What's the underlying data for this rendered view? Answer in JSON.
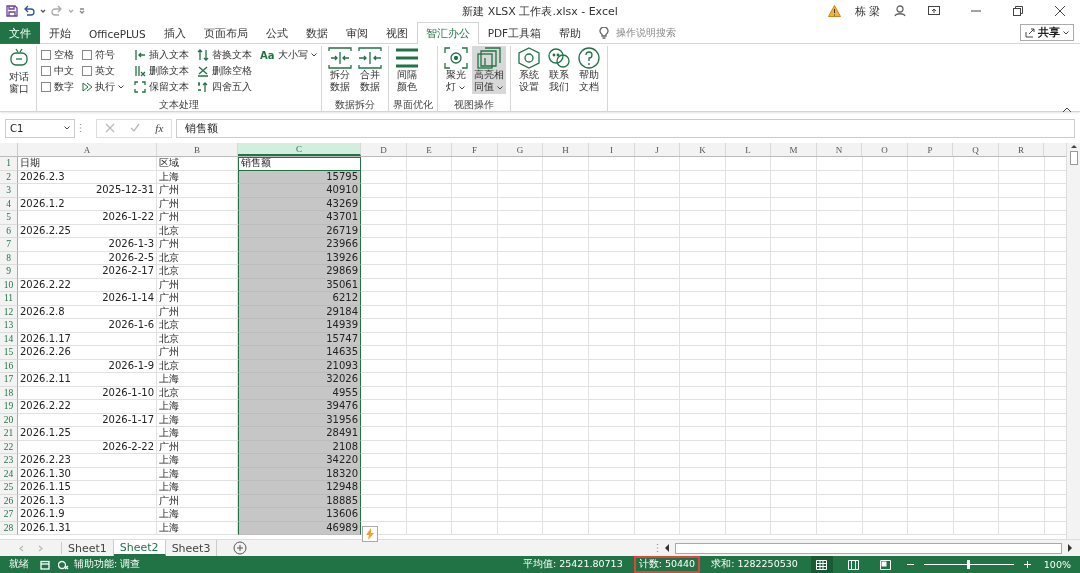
{
  "window": {
    "title": "新建 XLSX 工作表.xlsx  -  Excel",
    "user": "栋 梁"
  },
  "tabs": [
    {
      "label": "文件",
      "kind": "file",
      "selected": false
    },
    {
      "label": "开始",
      "kind": "tab",
      "selected": false
    },
    {
      "label": "OfficePLUS",
      "kind": "tab",
      "selected": false
    },
    {
      "label": "插入",
      "kind": "tab",
      "selected": false
    },
    {
      "label": "页面布局",
      "kind": "tab",
      "selected": false
    },
    {
      "label": "公式",
      "kind": "tab",
      "selected": false
    },
    {
      "label": "数据",
      "kind": "tab",
      "selected": false
    },
    {
      "label": "审阅",
      "kind": "tab",
      "selected": false
    },
    {
      "label": "视图",
      "kind": "tab",
      "selected": false
    },
    {
      "label": "智汇办公",
      "kind": "tab",
      "selected": true
    },
    {
      "label": "PDF工具箱",
      "kind": "tab",
      "selected": false
    },
    {
      "label": "帮助",
      "kind": "tab",
      "selected": false
    }
  ],
  "search": {
    "placeholder": "操作说明搜索"
  },
  "share_button": {
    "label": "共享"
  },
  "ribbon": {
    "chat_button": {
      "lines": [
        "对话",
        "窗口"
      ]
    },
    "text_group": {
      "label": "文本处理",
      "checkboxes": [
        {
          "label": "空格",
          "checked": false
        },
        {
          "label": "符号",
          "checked": false
        },
        {
          "label": "中文",
          "checked": false
        },
        {
          "label": "英文",
          "checked": false
        },
        {
          "label": "数字",
          "checked": false
        }
      ],
      "run_button": {
        "label": "执行"
      },
      "tools": [
        {
          "label": "插入文本"
        },
        {
          "label": "替换文本"
        },
        {
          "label": "删除文本"
        },
        {
          "label": "删除空格"
        },
        {
          "label": "保留文本"
        },
        {
          "label": "四舍五入"
        }
      ],
      "case_button": {
        "prefix": "Aa",
        "label": "大小写"
      }
    },
    "groups": [
      {
        "label": "数据拆分",
        "buttons": [
          {
            "lines": [
              "拆分",
              "数据"
            ],
            "dropdown": false,
            "selected": false
          },
          {
            "lines": [
              "合并",
              "数据"
            ],
            "dropdown": false,
            "selected": false
          }
        ]
      },
      {
        "label": "界面优化",
        "buttons": [
          {
            "lines": [
              "间隔",
              "颜色"
            ],
            "dropdown": false,
            "selected": false
          }
        ]
      },
      {
        "label": "视图操作",
        "buttons": [
          {
            "lines": [
              "聚光",
              "灯"
            ],
            "dropdown": true,
            "selected": false
          },
          {
            "lines": [
              "高亮相",
              "同值"
            ],
            "dropdown": true,
            "selected": true
          }
        ]
      },
      {
        "buttons": [
          {
            "lines": [
              "系统",
              "设置"
            ],
            "dropdown": false,
            "selected": false
          },
          {
            "lines": [
              "联系",
              "我们"
            ],
            "dropdown": false,
            "selected": false
          },
          {
            "lines": [
              "帮助",
              "文档"
            ],
            "dropdown": false,
            "selected": false
          }
        ]
      }
    ]
  },
  "formula_bar": {
    "name_box": "C1",
    "fx": "fx",
    "formula": "销售额"
  },
  "table": {
    "columns": [
      {
        "label": "A",
        "selected": false
      },
      {
        "label": "B",
        "selected": false
      },
      {
        "label": "C",
        "selected": true
      },
      {
        "label": "D",
        "selected": false
      },
      {
        "label": "E",
        "selected": false
      },
      {
        "label": "F",
        "selected": false
      },
      {
        "label": "G",
        "selected": false
      },
      {
        "label": "H",
        "selected": false
      },
      {
        "label": "I",
        "selected": false
      },
      {
        "label": "J",
        "selected": false
      },
      {
        "label": "K",
        "selected": false
      },
      {
        "label": "L",
        "selected": false
      },
      {
        "label": "M",
        "selected": false
      },
      {
        "label": "N",
        "selected": false
      },
      {
        "label": "O",
        "selected": false
      },
      {
        "label": "P",
        "selected": false
      },
      {
        "label": "Q",
        "selected": false
      },
      {
        "label": "R",
        "selected": false
      }
    ],
    "rows": [
      {
        "number": "1",
        "cells": [
          {
            "text": "日期",
            "kind": "text"
          },
          {
            "text": "区域",
            "kind": "text"
          },
          {
            "text": "销售额",
            "kind": "text"
          }
        ]
      },
      {
        "number": "2",
        "cells": [
          {
            "text": "2026.2.3",
            "kind": "text"
          },
          {
            "text": "上海",
            "kind": "text"
          },
          {
            "text": "15795",
            "kind": "number"
          }
        ]
      },
      {
        "number": "3",
        "cells": [
          {
            "text": "2025-12-31",
            "kind": "date"
          },
          {
            "text": "广州",
            "kind": "text"
          },
          {
            "text": "40910",
            "kind": "number"
          }
        ]
      },
      {
        "number": "4",
        "cells": [
          {
            "text": "2026.1.2",
            "kind": "text"
          },
          {
            "text": "广州",
            "kind": "text"
          },
          {
            "text": "43269",
            "kind": "number"
          }
        ]
      },
      {
        "number": "5",
        "cells": [
          {
            "text": "2026-1-22",
            "kind": "date"
          },
          {
            "text": "广州",
            "kind": "text"
          },
          {
            "text": "43701",
            "kind": "number"
          }
        ]
      },
      {
        "number": "6",
        "cells": [
          {
            "text": "2026.2.25",
            "kind": "text"
          },
          {
            "text": "北京",
            "kind": "text"
          },
          {
            "text": "26719",
            "kind": "number"
          }
        ]
      },
      {
        "number": "7",
        "cells": [
          {
            "text": "2026-1-3",
            "kind": "date"
          },
          {
            "text": "广州",
            "kind": "text"
          },
          {
            "text": "23966",
            "kind": "number"
          }
        ]
      },
      {
        "number": "8",
        "cells": [
          {
            "text": "2026-2-5",
            "kind": "date"
          },
          {
            "text": "北京",
            "kind": "text"
          },
          {
            "text": "13926",
            "kind": "number"
          }
        ]
      },
      {
        "number": "9",
        "cells": [
          {
            "text": "2026-2-17",
            "kind": "date"
          },
          {
            "text": "北京",
            "kind": "text"
          },
          {
            "text": "29869",
            "kind": "number"
          }
        ]
      },
      {
        "number": "10",
        "cells": [
          {
            "text": "2026.2.22",
            "kind": "text"
          },
          {
            "text": "广州",
            "kind": "text"
          },
          {
            "text": "35061",
            "kind": "number"
          }
        ]
      },
      {
        "number": "11",
        "cells": [
          {
            "text": "2026-1-14",
            "kind": "date"
          },
          {
            "text": "广州",
            "kind": "text"
          },
          {
            "text": "6212",
            "kind": "number"
          }
        ]
      },
      {
        "number": "12",
        "cells": [
          {
            "text": "2026.2.8",
            "kind": "text"
          },
          {
            "text": "广州",
            "kind": "text"
          },
          {
            "text": "29184",
            "kind": "number"
          }
        ]
      },
      {
        "number": "13",
        "cells": [
          {
            "text": "2026-1-6",
            "kind": "date"
          },
          {
            "text": "北京",
            "kind": "text"
          },
          {
            "text": "14939",
            "kind": "number"
          }
        ]
      },
      {
        "number": "14",
        "cells": [
          {
            "text": "2026.1.17",
            "kind": "text"
          },
          {
            "text": "北京",
            "kind": "text"
          },
          {
            "text": "15747",
            "kind": "number"
          }
        ]
      },
      {
        "number": "15",
        "cells": [
          {
            "text": "2026.2.26",
            "kind": "text"
          },
          {
            "text": "广州",
            "kind": "text"
          },
          {
            "text": "14635",
            "kind": "number"
          }
        ]
      },
      {
        "number": "16",
        "cells": [
          {
            "text": "2026-1-9",
            "kind": "date"
          },
          {
            "text": "北京",
            "kind": "text"
          },
          {
            "text": "21093",
            "kind": "number"
          }
        ]
      },
      {
        "number": "17",
        "cells": [
          {
            "text": "2026.2.11",
            "kind": "text"
          },
          {
            "text": "上海",
            "kind": "text"
          },
          {
            "text": "32026",
            "kind": "number"
          }
        ]
      },
      {
        "number": "18",
        "cells": [
          {
            "text": "2026-1-10",
            "kind": "date"
          },
          {
            "text": "北京",
            "kind": "text"
          },
          {
            "text": "4955",
            "kind": "number"
          }
        ]
      },
      {
        "number": "19",
        "cells": [
          {
            "text": "2026.2.22",
            "kind": "text"
          },
          {
            "text": "上海",
            "kind": "text"
          },
          {
            "text": "39476",
            "kind": "number"
          }
        ]
      },
      {
        "number": "20",
        "cells": [
          {
            "text": "2026-1-17",
            "kind": "date"
          },
          {
            "text": "上海",
            "kind": "text"
          },
          {
            "text": "31956",
            "kind": "number"
          }
        ]
      },
      {
        "number": "21",
        "cells": [
          {
            "text": "2026.1.25",
            "kind": "text"
          },
          {
            "text": "上海",
            "kind": "text"
          },
          {
            "text": "28491",
            "kind": "number"
          }
        ]
      },
      {
        "number": "22",
        "cells": [
          {
            "text": "2026-2-22",
            "kind": "date"
          },
          {
            "text": "广州",
            "kind": "text"
          },
          {
            "text": "2108",
            "kind": "number"
          }
        ]
      },
      {
        "number": "23",
        "cells": [
          {
            "text": "2026.2.23",
            "kind": "text"
          },
          {
            "text": "上海",
            "kind": "text"
          },
          {
            "text": "34220",
            "kind": "number"
          }
        ]
      },
      {
        "number": "24",
        "cells": [
          {
            "text": "2026.1.30",
            "kind": "text"
          },
          {
            "text": "上海",
            "kind": "text"
          },
          {
            "text": "18320",
            "kind": "number"
          }
        ]
      },
      {
        "number": "25",
        "cells": [
          {
            "text": "2026.1.15",
            "kind": "text"
          },
          {
            "text": "上海",
            "kind": "text"
          },
          {
            "text": "12948",
            "kind": "number"
          }
        ]
      },
      {
        "number": "26",
        "cells": [
          {
            "text": "2026.1.3",
            "kind": "text"
          },
          {
            "text": "广州",
            "kind": "text"
          },
          {
            "text": "18885",
            "kind": "number"
          }
        ]
      },
      {
        "number": "27",
        "cells": [
          {
            "text": "2026.1.9",
            "kind": "text"
          },
          {
            "text": "上海",
            "kind": "text"
          },
          {
            "text": "13606",
            "kind": "number"
          }
        ]
      },
      {
        "number": "28",
        "cells": [
          {
            "text": "2026.1.31",
            "kind": "text"
          },
          {
            "text": "上海",
            "kind": "text"
          },
          {
            "text": "46989",
            "kind": "number"
          }
        ]
      }
    ]
  },
  "sheet_tabs": [
    {
      "label": "Sheet1",
      "selected": false
    },
    {
      "label": "Sheet2",
      "selected": true
    },
    {
      "label": "Sheet3",
      "selected": false
    }
  ],
  "status_bar": {
    "ready": "就绪",
    "accessibility": "辅助功能: 调查",
    "stats": [
      {
        "text": "平均值: 25421.80713",
        "highlighted": false
      },
      {
        "text": "计数: 50440",
        "highlighted": true
      },
      {
        "text": "求和: 1282250530",
        "highlighted": false
      }
    ],
    "zoom": {
      "level": 0.5,
      "label": "100%"
    }
  }
}
